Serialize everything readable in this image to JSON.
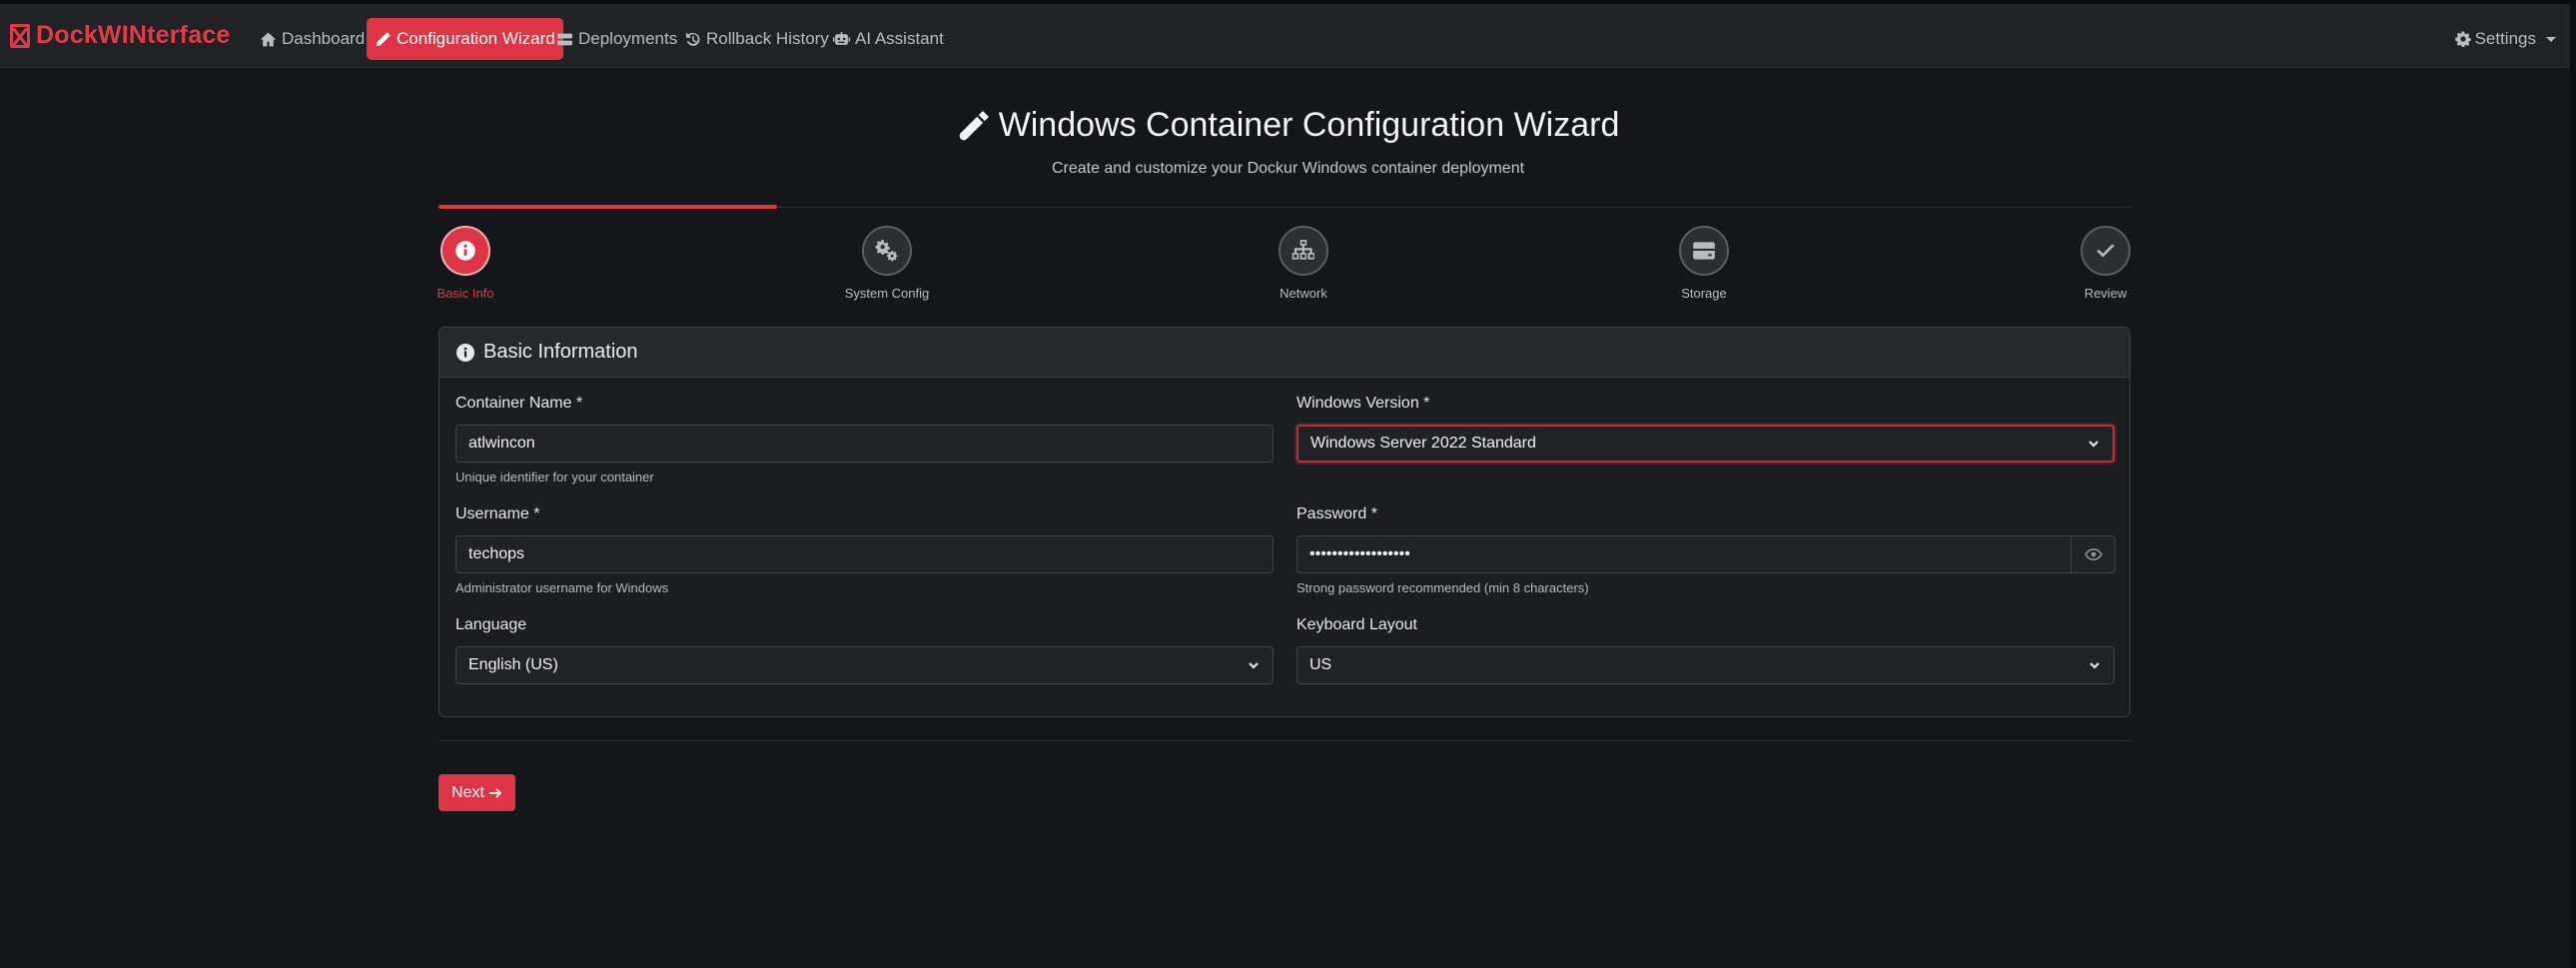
{
  "app": {
    "name": "DockWINterface"
  },
  "nav": {
    "items": [
      {
        "label": "Dashboard",
        "icon": "home-icon"
      },
      {
        "label": "Configuration Wizard",
        "icon": "pencil-icon",
        "active": true
      },
      {
        "label": "Deployments",
        "icon": "server-icon"
      },
      {
        "label": "Rollback History",
        "icon": "history-icon"
      },
      {
        "label": "AI Assistant",
        "icon": "robot-icon"
      }
    ],
    "settings_label": "Settings"
  },
  "header": {
    "title": "Windows Container Configuration Wizard",
    "subtitle": "Create and customize your Dockur Windows container deployment"
  },
  "wizard": {
    "progress_fraction": 0.2,
    "steps": [
      {
        "label": "Basic Info",
        "icon": "info-icon",
        "active": true
      },
      {
        "label": "System Config",
        "icon": "gears-icon"
      },
      {
        "label": "Network",
        "icon": "network-icon"
      },
      {
        "label": "Storage",
        "icon": "hdd-icon"
      },
      {
        "label": "Review",
        "icon": "check-icon"
      }
    ]
  },
  "form": {
    "section_title": "Basic Information",
    "container_name": {
      "label": "Container Name *",
      "value": "atlwincon",
      "help": "Unique identifier for your container"
    },
    "windows_version": {
      "label": "Windows Version *",
      "value": "Windows Server 2022 Standard"
    },
    "username": {
      "label": "Username *",
      "value": "techops",
      "help": "Administrator username for Windows"
    },
    "password": {
      "label": "Password *",
      "value": "••••••••••••••••••",
      "help": "Strong password recommended (min 8 characters)"
    },
    "language": {
      "label": "Language",
      "value": "English (US)"
    },
    "keyboard_layout": {
      "label": "Keyboard Layout",
      "value": "US"
    }
  },
  "actions": {
    "next_label": "Next"
  },
  "colors": {
    "accent": "#dc3545",
    "background": "#14161a",
    "navbar": "#202226"
  }
}
